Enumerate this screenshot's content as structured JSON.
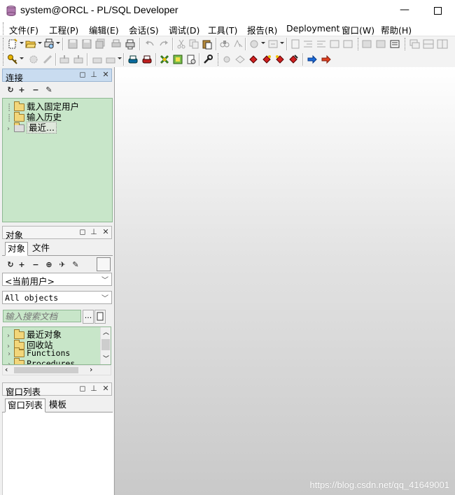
{
  "window": {
    "title": "system@ORCL - PL/SQL Developer",
    "minimize_glyph": "—"
  },
  "menu": [
    {
      "label": "文件(F)"
    },
    {
      "label": "工程(P)"
    },
    {
      "label": "编辑(E)"
    },
    {
      "label": "会话(S)"
    },
    {
      "label": "调试(D)"
    },
    {
      "label": "工具(T)"
    },
    {
      "label": "报告(R)"
    },
    {
      "label": "Deployment"
    },
    {
      "label": "窗口(W)"
    },
    {
      "label": "帮助(H)"
    }
  ],
  "connect_pane": {
    "title": "连接",
    "tree": [
      {
        "label": "载入固定用户"
      },
      {
        "label": "输入历史"
      },
      {
        "label": "最近..."
      }
    ]
  },
  "objects_pane": {
    "title": "对象",
    "tabs": [
      {
        "label": "对象"
      },
      {
        "label": "文件"
      }
    ],
    "owner_combo": "<当前用户>",
    "type_combo": "All objects",
    "search_placeholder": "输入搜索文档",
    "browse_button": "...",
    "tree": [
      {
        "label": "最近对象"
      },
      {
        "label": "回收站"
      },
      {
        "label": "Functions"
      },
      {
        "label": "Procedures"
      }
    ]
  },
  "window_list_pane": {
    "title": "窗口列表",
    "tabs": [
      {
        "label": "窗口列表"
      },
      {
        "label": "模板"
      }
    ]
  },
  "watermark": "https://blog.csdn.net/qq_41649001",
  "colors": {
    "tree_background": "#c8e6c9",
    "active_header": "#c9dcf0"
  }
}
